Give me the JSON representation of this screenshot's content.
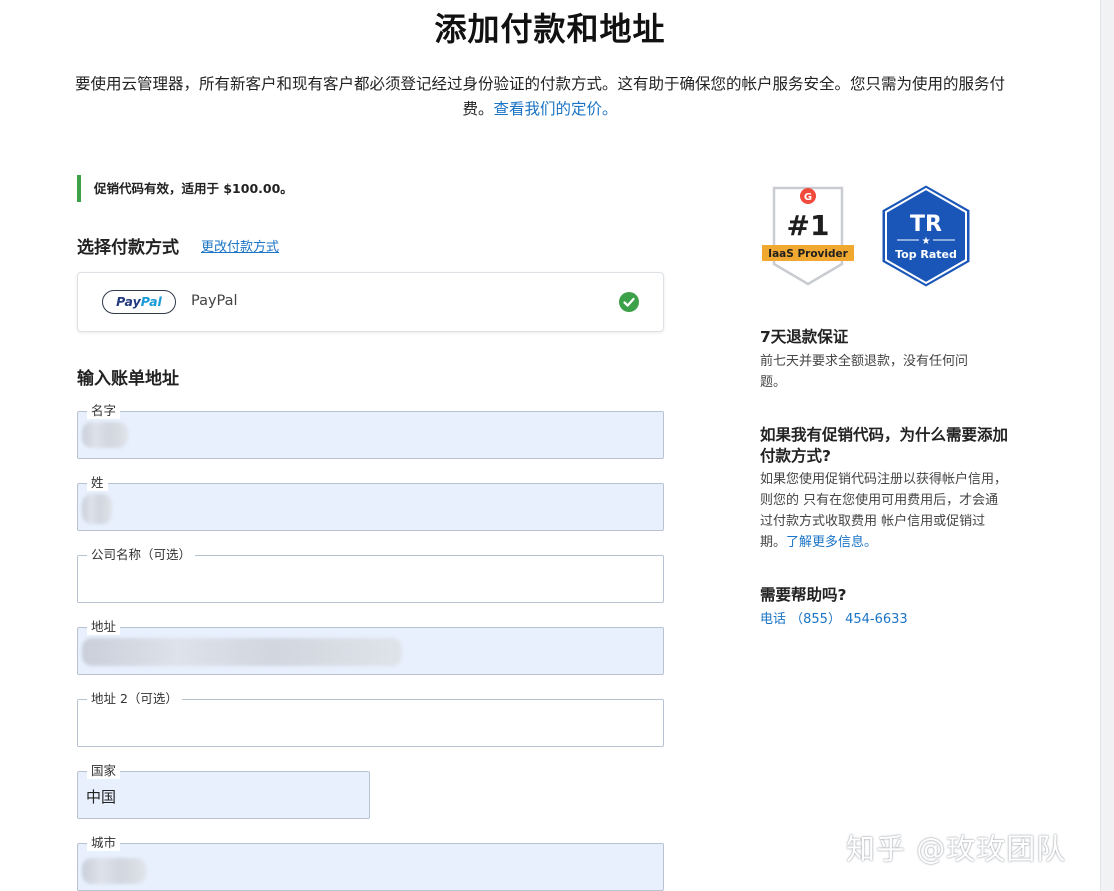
{
  "page": {
    "title": "添加付款和地址",
    "intro_text": "要使用云管理器，所有新客户和现有客户都必须登记经过身份验证的付款方式。这有助于确保您的帐户服务安全。您只需为使用的服务付费。",
    "intro_link": "查看我们的定价。"
  },
  "promo": {
    "text": "促销代码有效，适用于 $100.00。",
    "accent_color": "#3da14a"
  },
  "payment": {
    "section_title": "选择付款方式",
    "change_link": "更改付款方式",
    "method_logo_part1": "Pay",
    "method_logo_part2": "Pal",
    "method_label": "PayPal",
    "selected_icon": "check-circle-icon"
  },
  "billing": {
    "section_title": "输入账单地址",
    "fields": [
      {
        "label": "名字",
        "value": ""
      },
      {
        "label": "姓",
        "value": ""
      },
      {
        "label": "公司名称（可选）",
        "value": ""
      },
      {
        "label": "地址",
        "value": ""
      },
      {
        "label": "地址 2（可选）",
        "value": ""
      },
      {
        "label": "国家",
        "value": "中国"
      },
      {
        "label": "城市",
        "value": ""
      }
    ]
  },
  "badges": {
    "g2_logo": "G",
    "g2_rank": "#1",
    "g2_ribbon": "IaaS Provider",
    "tr_logo": "TR",
    "tr_star": "★",
    "tr_text": "Top Rated"
  },
  "sidebar": {
    "refund_heading": "7天退款保证",
    "refund_text": "前七天并要求全额退款，没有任何问题。",
    "promo_heading": "如果我有促销代码，为什么需要添加付款方式?",
    "promo_text": "如果您使用促销代码注册以获得帐户信用，则您的 只有在您使用可用费用后，才会通过付款方式收取费用 帐户信用或促销过期。",
    "promo_link": "了解更多信息。",
    "help_heading": "需要帮助吗?",
    "phone_link": "电话 （855） 454-6633"
  },
  "watermark": {
    "text": "知乎 @玫玫团队"
  },
  "colors": {
    "link": "#1b74c5",
    "autofill_bg": "#e8f0fe",
    "success": "#3da14a",
    "badge_blue": "#1a56b8",
    "badge_orange": "#f0a830",
    "g2_red": "#ef4a3b"
  }
}
